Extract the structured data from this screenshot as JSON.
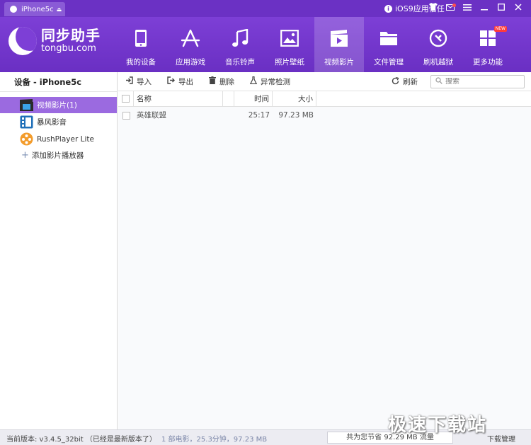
{
  "titlebar": {
    "device_tab": "iPhone5c",
    "trust_label": "iOS9应用信任",
    "buttons": [
      "shirt-icon",
      "mail-icon",
      "menu-icon",
      "minimize-icon",
      "maximize-icon",
      "close-icon"
    ]
  },
  "header": {
    "logo_cn": "同步助手",
    "logo_en": "tongbu.com",
    "nav": [
      {
        "label": "我的设备",
        "icon": "phone-icon"
      },
      {
        "label": "应用游戏",
        "icon": "app-store-icon"
      },
      {
        "label": "音乐铃声",
        "icon": "music-note-icon"
      },
      {
        "label": "照片壁纸",
        "icon": "picture-icon"
      },
      {
        "label": "视频影片",
        "icon": "clapperboard-icon",
        "active": true
      },
      {
        "label": "文件管理",
        "icon": "folder-icon"
      },
      {
        "label": "刷机越狱",
        "icon": "refresh-circle-icon"
      },
      {
        "label": "更多功能",
        "icon": "grid-icon",
        "badge": "NEW"
      }
    ]
  },
  "sidebar": {
    "title": "设备 - iPhone5c",
    "items": [
      {
        "label": "视频影片(1)",
        "icon": "video-icon",
        "active": true
      },
      {
        "label": "暴风影音",
        "icon": "baofeng-icon"
      },
      {
        "label": "RushPlayer Lite",
        "icon": "rushplayer-icon"
      }
    ],
    "add_label": "添加影片播放器"
  },
  "toolbar": {
    "import": "导入",
    "export": "导出",
    "delete": "删除",
    "check": "异常检测",
    "refresh": "刷新",
    "search_placeholder": "搜索"
  },
  "table": {
    "headers": {
      "name": "名称",
      "time": "时间",
      "size": "大小"
    },
    "rows": [
      {
        "name": "英雄联盟",
        "time": "25:17",
        "size": "97.23 MB"
      }
    ]
  },
  "statusbar": {
    "version": "当前版本: v3.4.5_32bit （已经是最新版本了）",
    "count": "1 部电影，25.3分钟，97.23 MB",
    "saved": "共为您节省  92.29 MB 流量",
    "download": "下载管理"
  },
  "watermark": "极速下载站",
  "colors": {
    "brand": "#6b31c4",
    "active_item": "#9b6ae0"
  }
}
